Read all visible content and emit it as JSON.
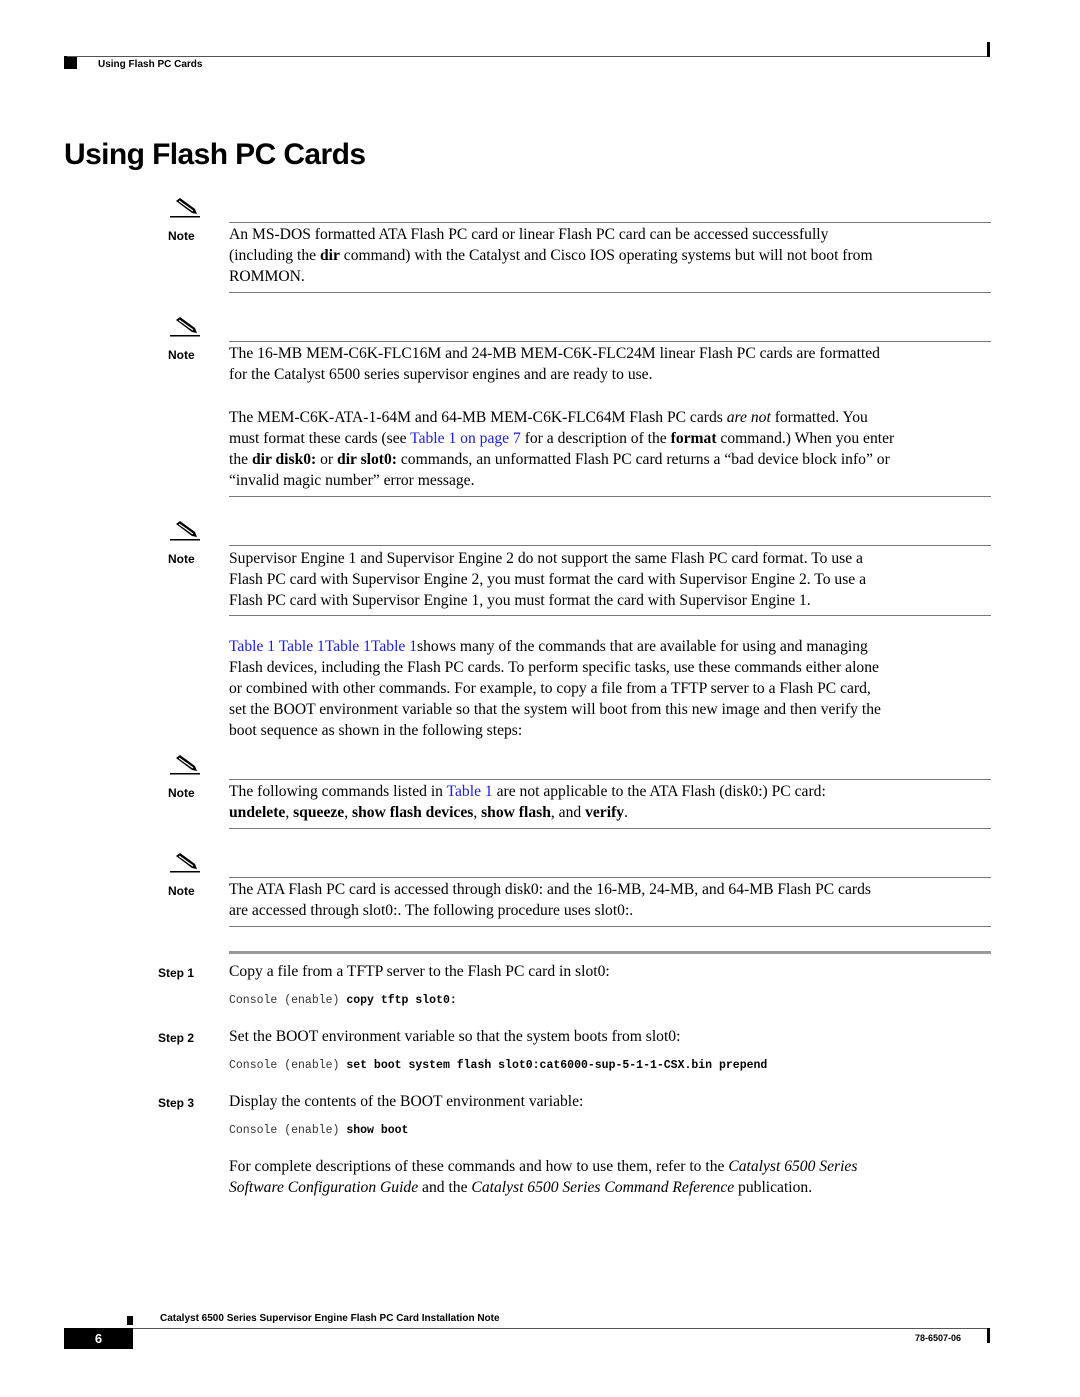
{
  "header": {
    "running_title": "Using Flash PC Cards"
  },
  "page_title": "Using Flash PC Cards",
  "note_label": "Note",
  "notes": [
    {
      "lines": [
        "An MS-DOS formatted ATA Flash PC card or linear Flash PC card can be accessed successfully",
        [
          "(including the ",
          {
            "b": "dir"
          },
          " command) with the Catalyst and Cisco IOS operating systems but will not boot from"
        ],
        "ROMMON."
      ]
    },
    {
      "lines": [
        "The 16-MB MEM-C6K-FLC16M and 24-MB MEM-C6K-FLC24M linear Flash PC cards are formatted",
        "for the Catalyst 6500 series supervisor engines and are ready to use."
      ],
      "para2": [
        [
          "The MEM-C6K-ATA-1-64M and 64-MB MEM-C6K-FLC64M Flash PC cards ",
          {
            "i": "are not"
          },
          " formatted. You"
        ],
        [
          "must format these cards (see ",
          {
            "a": "Table 1 on page 7"
          },
          " for a description of the ",
          {
            "b": "format"
          },
          " command.) When you enter"
        ],
        [
          "the ",
          {
            "b": "dir disk0:"
          },
          " or ",
          {
            "b": "dir slot0:"
          },
          " commands, an unformatted Flash PC card returns a “bad device block info” or"
        ],
        "“invalid magic number” error message."
      ]
    },
    {
      "lines": [
        "Supervisor Engine 1 and Supervisor Engine 2 do not support the same Flash PC card format. To use a",
        "Flash PC card with Supervisor Engine 2, you must format the card with Supervisor Engine 2. To use a",
        "Flash PC card with Supervisor Engine 1, you must format the card with Supervisor Engine 1."
      ]
    },
    {
      "lines": [
        [
          "The following commands listed in ",
          {
            "a": "Table 1"
          },
          " are not applicable to the ATA Flash (disk0:) PC card:"
        ],
        [
          {
            "b": "undelete"
          },
          ", ",
          {
            "b": "squeeze"
          },
          ", ",
          {
            "b": "show flash devices"
          },
          ", ",
          {
            "b": "show flash"
          },
          ", and ",
          {
            "b": "verify"
          },
          "."
        ]
      ]
    },
    {
      "lines": [
        "The ATA Flash PC card is accessed through disk0: and the 16-MB, 24-MB, and 64-MB Flash PC cards",
        "are accessed through slot0:. The following procedure uses slot0:."
      ]
    }
  ],
  "intro_paragraph": [
    [
      {
        "a": "Table 1 Table 1Table 1Table 1"
      },
      "shows many of the commands that are available for using and managing"
    ],
    "Flash devices, including the Flash PC cards. To perform specific tasks, use these commands either alone",
    "or combined with other commands. For example, to copy a file from a TFTP server to a Flash PC card,",
    "set the BOOT environment variable so that the system will boot from this new image and then verify the",
    "boot sequence as shown in the following steps:"
  ],
  "steps": [
    {
      "label": "Step 1",
      "text": "Copy a file from a TFTP server to the Flash PC card in slot0:",
      "prompt": "Console (enable) ",
      "command": "copy tftp slot0:"
    },
    {
      "label": "Step 2",
      "text": "Set the BOOT environment variable so that the system boots from slot0:",
      "prompt": "Console (enable) ",
      "command": "set boot system flash slot0:cat6000-sup-5-1-1-CSX.bin prepend"
    },
    {
      "label": "Step 3",
      "text": "Display the contents of the BOOT environment variable:",
      "prompt": "Console (enable) ",
      "command": "show boot"
    }
  ],
  "closing_paragraph": [
    [
      "For complete descriptions of these commands and how to use them, refer to the ",
      {
        "i": "Catalyst 6500 Series"
      }
    ],
    [
      {
        "i": "Software Configuration Guide"
      },
      " and the ",
      {
        "i": "Catalyst 6500 Series Command Reference"
      },
      " publication."
    ]
  ],
  "footer": {
    "doc_title": "Catalyst 6500 Series Supervisor Engine Flash PC Card Installation Note",
    "page_number": "6",
    "doc_number": "78-6507-06"
  },
  "colors": {
    "link": "#1a1aee",
    "rule": "#777777"
  }
}
